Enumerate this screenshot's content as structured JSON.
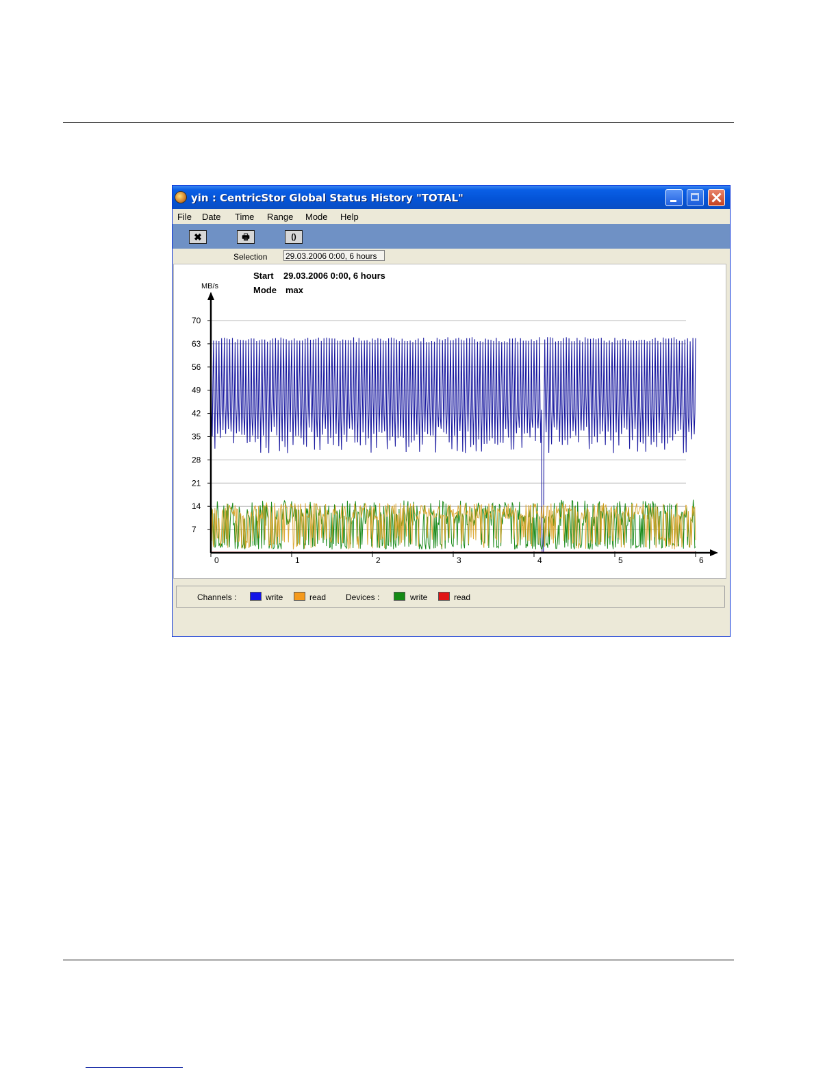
{
  "window": {
    "title": "yin : CentricStor Global Status History \"TOTAL\"",
    "icon": "globe-app-icon"
  },
  "menu": [
    "File",
    "Date",
    "Time",
    "Range",
    "Mode",
    "Help"
  ],
  "toolbar": {
    "buttons": [
      {
        "name": "close-view-button",
        "icon": "x-icon",
        "glyph": "✖"
      },
      {
        "name": "print-button",
        "icon": "printer-icon",
        "glyph": "🖶"
      },
      {
        "name": "refresh-button",
        "icon": "refresh-icon",
        "glyph": "()"
      }
    ]
  },
  "selection": {
    "label": "Selection",
    "value": "29.03.2006  0:00, 6 hours"
  },
  "chart_info": {
    "start_label": "Start",
    "start_value": "29.03.2006  0:00, 6 hours",
    "mode_label": "Mode",
    "mode_value": "max"
  },
  "legend": {
    "channels_label": "Channels :",
    "devices_label": "Devices :",
    "items": [
      {
        "label": "write",
        "color": "#1414e6"
      },
      {
        "label": "read",
        "color": "#f59a1b"
      },
      {
        "label": "write",
        "color": "#148a14"
      },
      {
        "label": "read",
        "color": "#e01414"
      }
    ]
  },
  "chart_data": {
    "type": "line",
    "ylabel": "MB/s",
    "xlabel": "",
    "yticks": [
      7,
      14,
      21,
      28,
      35,
      42,
      49,
      56,
      63,
      70
    ],
    "xticks": [
      0,
      1,
      2,
      3,
      4,
      5,
      6
    ],
    "ylim": [
      0,
      70
    ],
    "xlim": [
      0,
      6
    ],
    "grid": true,
    "series": [
      {
        "name": "Channels write",
        "color": "#1a1aa0",
        "min": 28,
        "max": 65,
        "dropout": [
          4.1,
          4.12
        ]
      },
      {
        "name": "Channels read",
        "color": "#d8a020",
        "min": 1,
        "max": 15
      },
      {
        "name": "Devices write",
        "color": "#1a8a1a",
        "min": 1,
        "max": 16
      },
      {
        "name": "Devices read",
        "color": "#e01414",
        "min": 0,
        "max": 0
      }
    ]
  }
}
